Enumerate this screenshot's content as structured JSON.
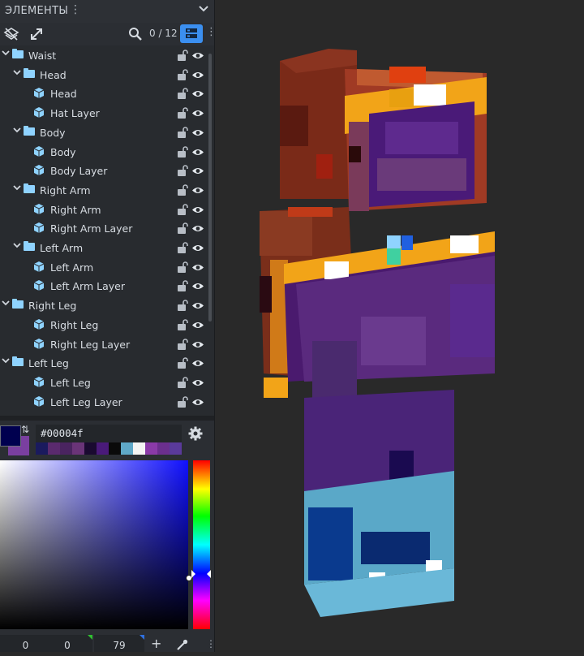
{
  "panel": {
    "title": "ЭЛЕМЕНТЫ",
    "count": "0 / 12"
  },
  "tree": [
    {
      "label": "Waist",
      "type": "folder",
      "indent": 0
    },
    {
      "label": "Head",
      "type": "folder",
      "indent": 1
    },
    {
      "label": "Head",
      "type": "cube",
      "indent": 2
    },
    {
      "label": "Hat Layer",
      "type": "cube",
      "indent": 2
    },
    {
      "label": "Body",
      "type": "folder",
      "indent": 1
    },
    {
      "label": "Body",
      "type": "cube",
      "indent": 2
    },
    {
      "label": "Body Layer",
      "type": "cube",
      "indent": 2
    },
    {
      "label": "Right Arm",
      "type": "folder",
      "indent": 1
    },
    {
      "label": "Right Arm",
      "type": "cube",
      "indent": 2
    },
    {
      "label": "Right Arm Layer",
      "type": "cube",
      "indent": 2
    },
    {
      "label": "Left Arm",
      "type": "folder",
      "indent": 1
    },
    {
      "label": "Left Arm",
      "type": "cube",
      "indent": 2
    },
    {
      "label": "Left Arm Layer",
      "type": "cube",
      "indent": 2
    },
    {
      "label": "Right Leg",
      "type": "folder",
      "indent": 0
    },
    {
      "label": "Right Leg",
      "type": "cube",
      "indent": 1
    },
    {
      "label": "Right Leg Layer",
      "type": "cube",
      "indent": 1
    },
    {
      "label": "Left Leg",
      "type": "folder",
      "indent": 0
    },
    {
      "label": "Left Leg",
      "type": "cube",
      "indent": 1
    },
    {
      "label": "Left Leg Layer",
      "type": "cube",
      "indent": 1
    }
  ],
  "color": {
    "hex": "#00004f",
    "primary": "#00004f",
    "secondary": "#7a3fa0",
    "palette": [
      "#1a1a5e",
      "#5a2a6e",
      "#4a2460",
      "#6a3478",
      "#1a0a30",
      "#4a1a7a",
      "#0a0a0a",
      "#5fa8c8",
      "#f4f4f4",
      "#8a3aa8",
      "#6b2f8e",
      "#5a3a9a"
    ],
    "r": "0",
    "g": "0",
    "b": "79"
  },
  "colors": {
    "accent": "#3b8ff0",
    "folder": "#8fd3ff",
    "cube": "#8fd3ff"
  }
}
